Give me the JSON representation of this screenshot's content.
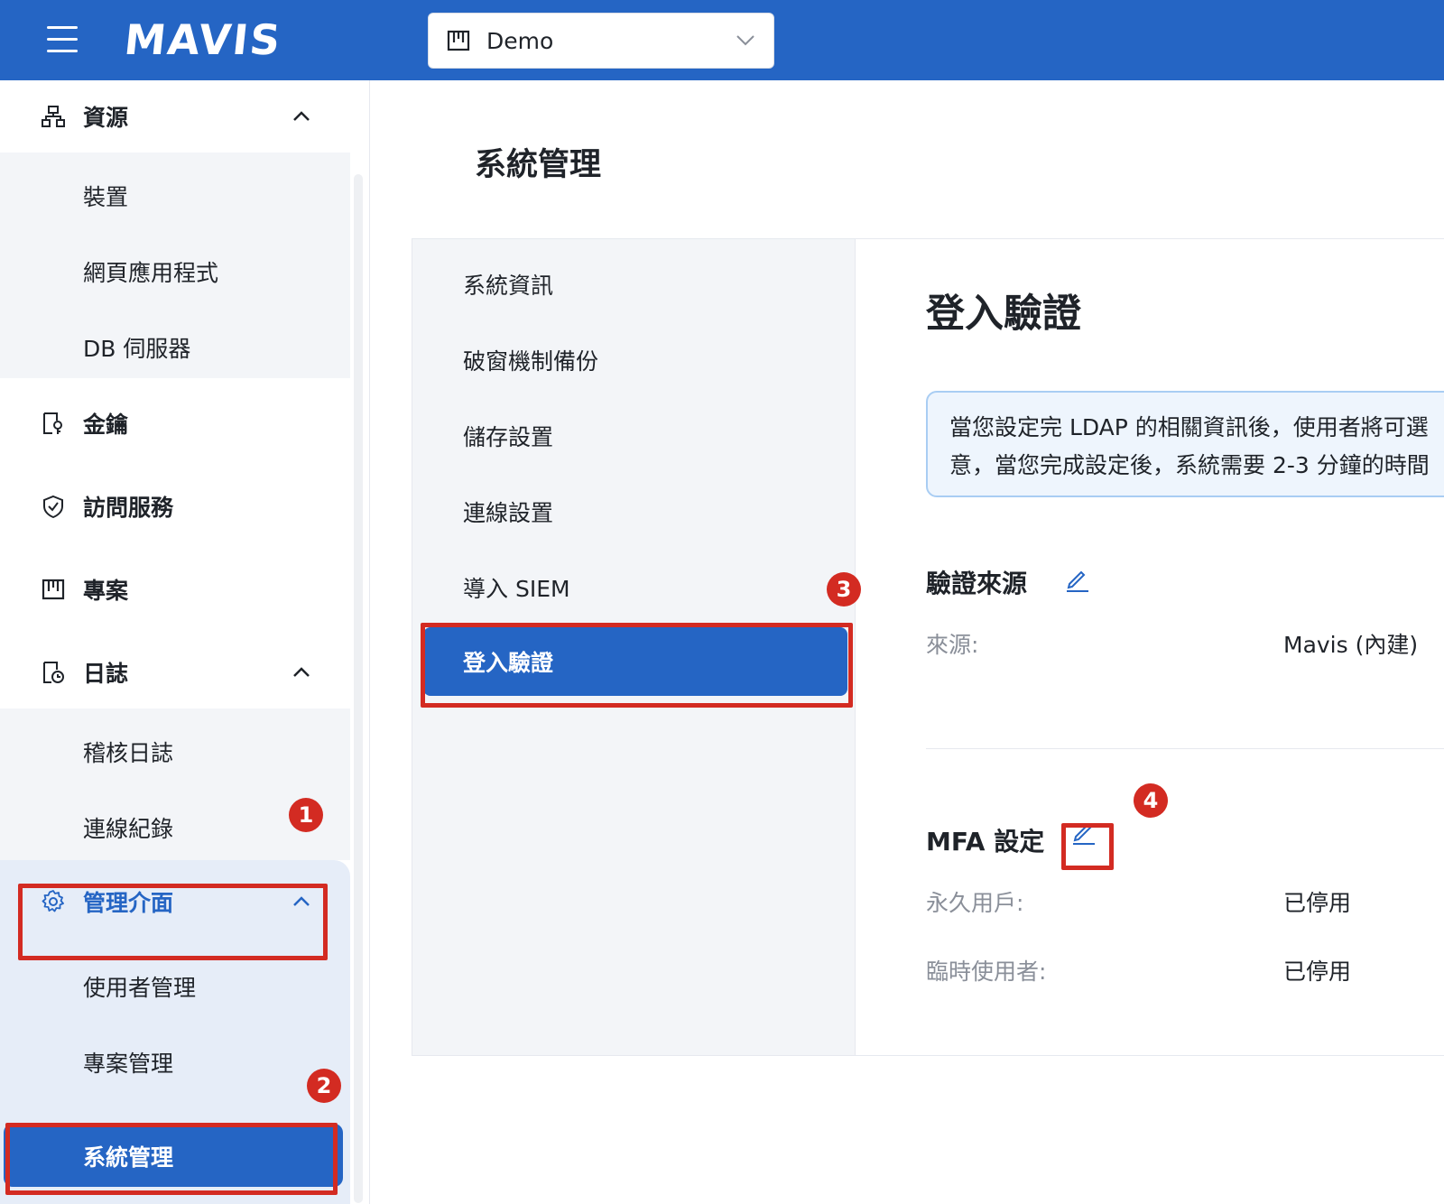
{
  "header": {
    "logo": "MAVIS",
    "project_select": {
      "value": "Demo"
    }
  },
  "sidebar": {
    "resources": {
      "label": "資源",
      "items": [
        "裝置",
        "網頁應用程式",
        "DB 伺服器"
      ]
    },
    "keys": {
      "label": "金鑰"
    },
    "access": {
      "label": "訪問服務"
    },
    "projects": {
      "label": "專案"
    },
    "logs": {
      "label": "日誌",
      "items": [
        "稽核日誌",
        "連線紀錄"
      ]
    },
    "admin": {
      "label": "管理介面",
      "items": [
        "使用者管理",
        "專案管理",
        "系統管理"
      ]
    }
  },
  "annotations": [
    "1",
    "2",
    "3",
    "4"
  ],
  "page": {
    "title": "系統管理"
  },
  "settings_nav": [
    "系統資訊",
    "破窗機制備份",
    "儲存設置",
    "連線設置",
    "導入 SIEM",
    "登入驗證"
  ],
  "content": {
    "title": "登入驗證",
    "info_line1": "當您設定完 LDAP 的相關資訊後，使用者將可選",
    "info_line2": "意，當您完成設定後，系統需要 2-3 分鐘的時間",
    "auth_source": {
      "heading": "驗證來源",
      "source_label": "來源:",
      "source_value": "Mavis (內建)"
    },
    "mfa": {
      "heading": "MFA 設定",
      "permanent_label": "永久用戶:",
      "permanent_value": "已停用",
      "temp_label": "臨時使用者:",
      "temp_value": "已停用"
    }
  },
  "colors": {
    "primary": "#2565c4",
    "annotation": "#d32b22",
    "info_bg": "#eef5fd"
  }
}
